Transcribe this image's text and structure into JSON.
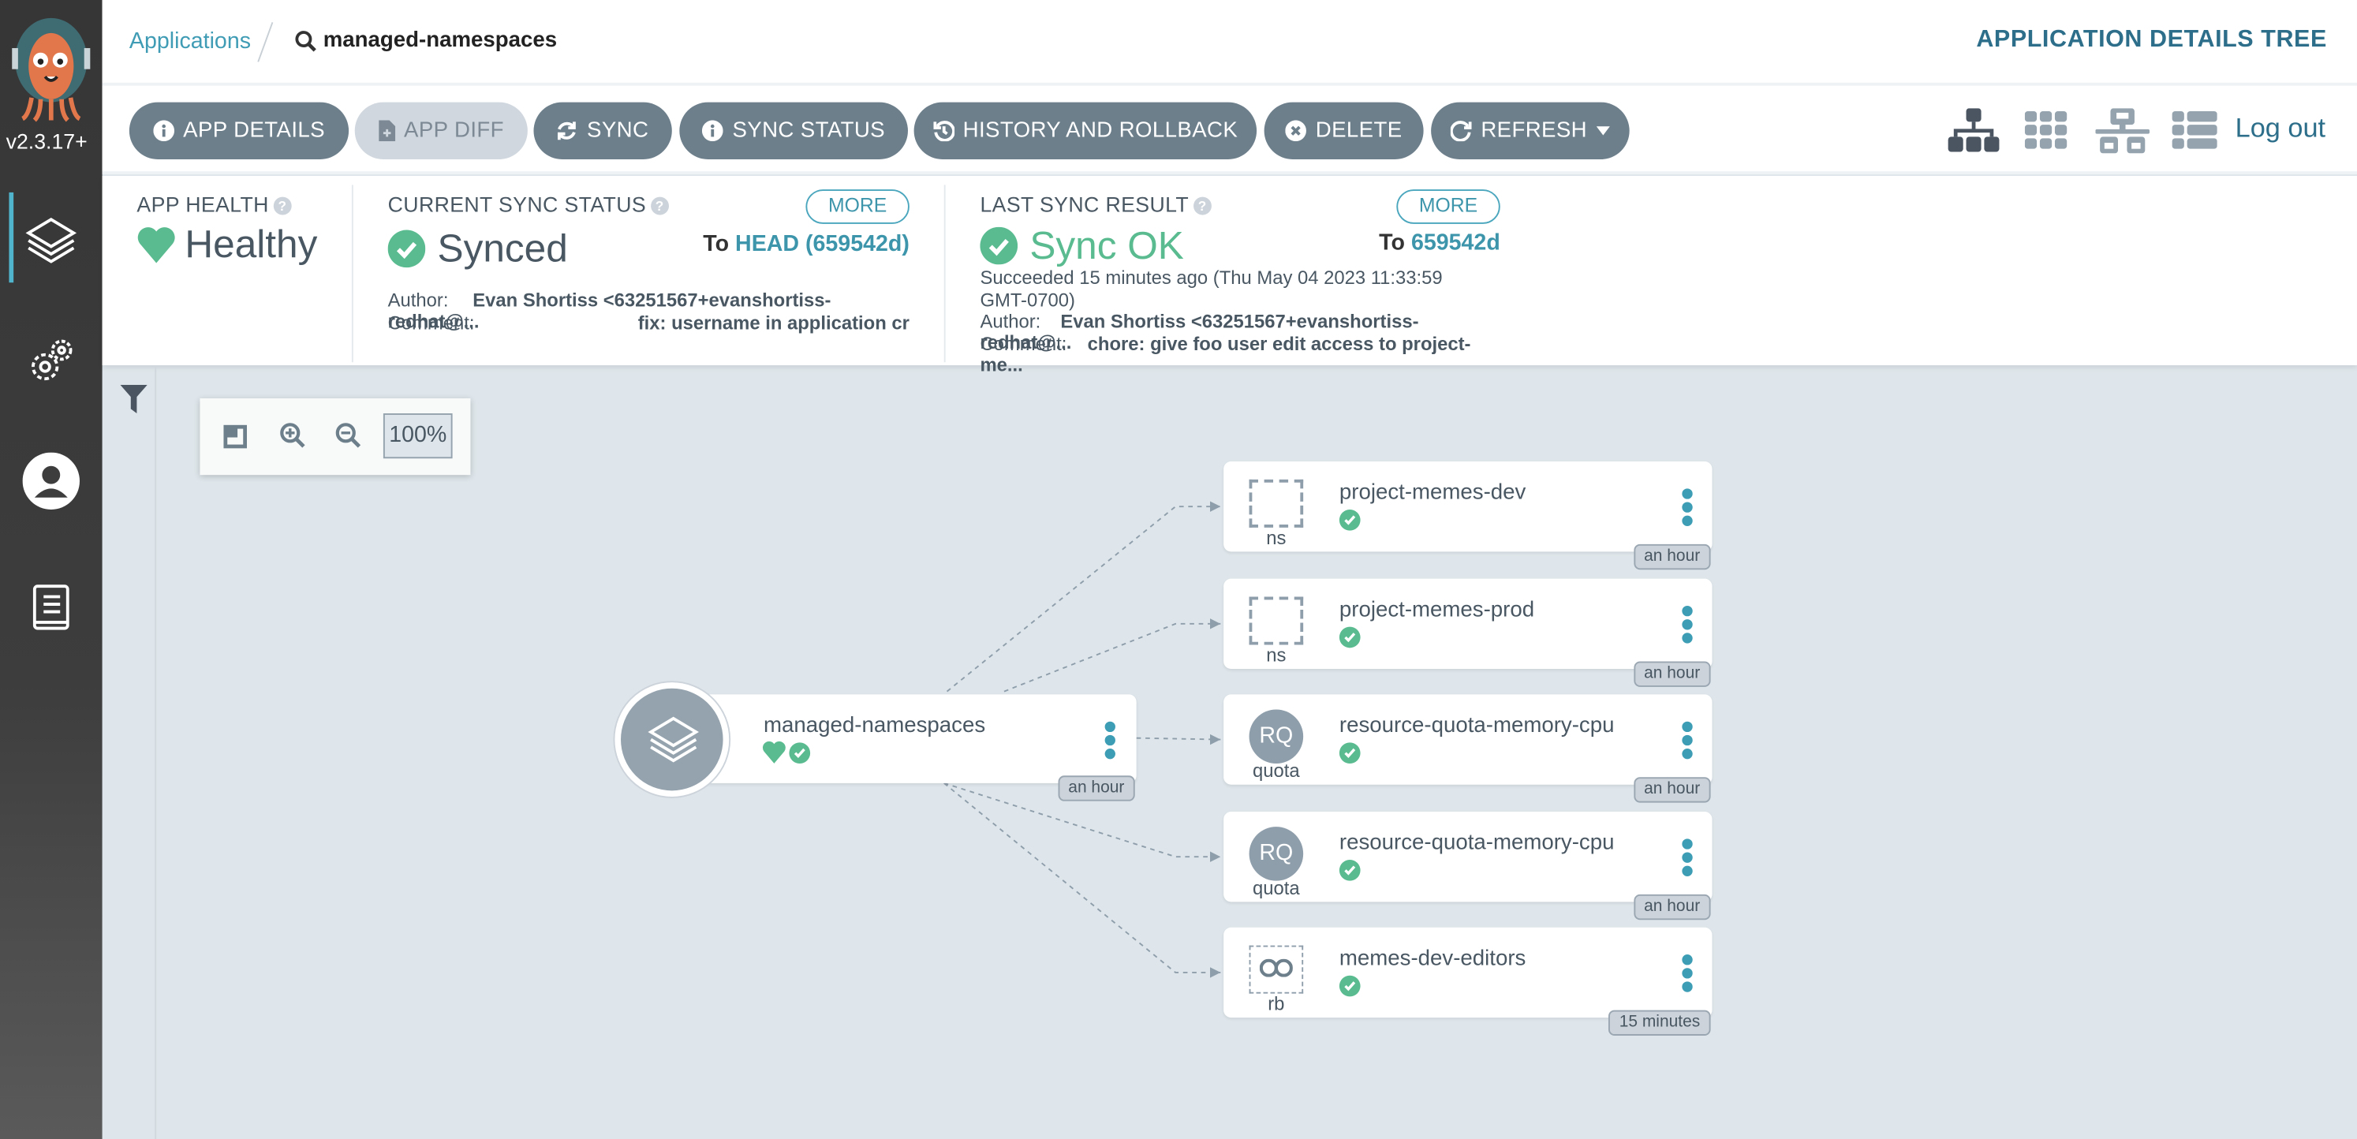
{
  "sidebar": {
    "version": "v2.3.17+",
    "items": [
      {
        "name": "applications",
        "icon": "layers-icon",
        "active": true
      },
      {
        "name": "settings",
        "icon": "gears-icon"
      },
      {
        "name": "user-info",
        "icon": "user-icon"
      },
      {
        "name": "documentation",
        "icon": "docs-icon"
      }
    ]
  },
  "header": {
    "breadcrumb_root": "Applications",
    "breadcrumb_current": "managed-namespaces",
    "title": "APPLICATION DETAILS TREE"
  },
  "toolbar": {
    "buttons": [
      {
        "label": "APP DETAILS",
        "icon": "info-icon"
      },
      {
        "label": "APP DIFF",
        "icon": "file-diff-icon",
        "disabled": true
      },
      {
        "label": "SYNC",
        "icon": "sync-icon"
      },
      {
        "label": "SYNC STATUS",
        "icon": "info-icon"
      },
      {
        "label": "HISTORY AND ROLLBACK",
        "icon": "history-icon"
      },
      {
        "label": "DELETE",
        "icon": "times-circle-icon"
      },
      {
        "label": "REFRESH",
        "icon": "redo-icon"
      }
    ],
    "views": [
      "tree-view-icon",
      "pods-view-icon",
      "network-view-icon",
      "list-view-icon"
    ],
    "active_view": "tree-view-icon",
    "logout": "Log out"
  },
  "status": {
    "health": {
      "label": "APP HEALTH",
      "value": "Healthy"
    },
    "current_sync": {
      "label": "CURRENT SYNC STATUS",
      "more": "MORE",
      "value": "Synced",
      "to_prefix": "To",
      "to_value": "HEAD (659542d)",
      "author_label": "Author:",
      "author": "Evan Shortiss <63251567+evanshortiss-redhat@...",
      "comment_label": "Comment:",
      "comment": "fix: username in application cr"
    },
    "last_sync": {
      "label": "LAST SYNC RESULT",
      "more": "MORE",
      "value": "Sync OK",
      "to_prefix": "To",
      "to_value": "659542d",
      "succeeded": "Succeeded 15 minutes ago (Thu May 04 2023 11:33:59 GMT-0700)",
      "author_label": "Author:",
      "author": "Evan Shortiss <63251567+evanshortiss-redhat@...",
      "comment_label": "Comment:",
      "comment": "chore: give foo user edit access to project-me..."
    }
  },
  "canvas": {
    "zoom": "100%",
    "root": {
      "name": "managed-namespaces",
      "age": "an hour",
      "health": "Healthy",
      "sync": "Synced"
    },
    "nodes": [
      {
        "name": "project-memes-dev",
        "kind": "ns",
        "icon": "dashed-box",
        "age": "an hour"
      },
      {
        "name": "project-memes-prod",
        "kind": "ns",
        "icon": "dashed-box",
        "age": "an hour"
      },
      {
        "name": "resource-quota-memory-cpu",
        "kind": "quota",
        "icon": "RQ",
        "age": "an hour"
      },
      {
        "name": "resource-quota-memory-cpu",
        "kind": "quota",
        "icon": "RQ",
        "age": "an hour"
      },
      {
        "name": "memes-dev-editors",
        "kind": "rb",
        "icon": "link",
        "age": "15 minutes"
      }
    ]
  },
  "colors": {
    "accent": "#3d95ab",
    "healthy": "#59bb8f",
    "button": "#6d7f8b",
    "sidebar": "#363636",
    "canvas": "#dee6eb"
  }
}
